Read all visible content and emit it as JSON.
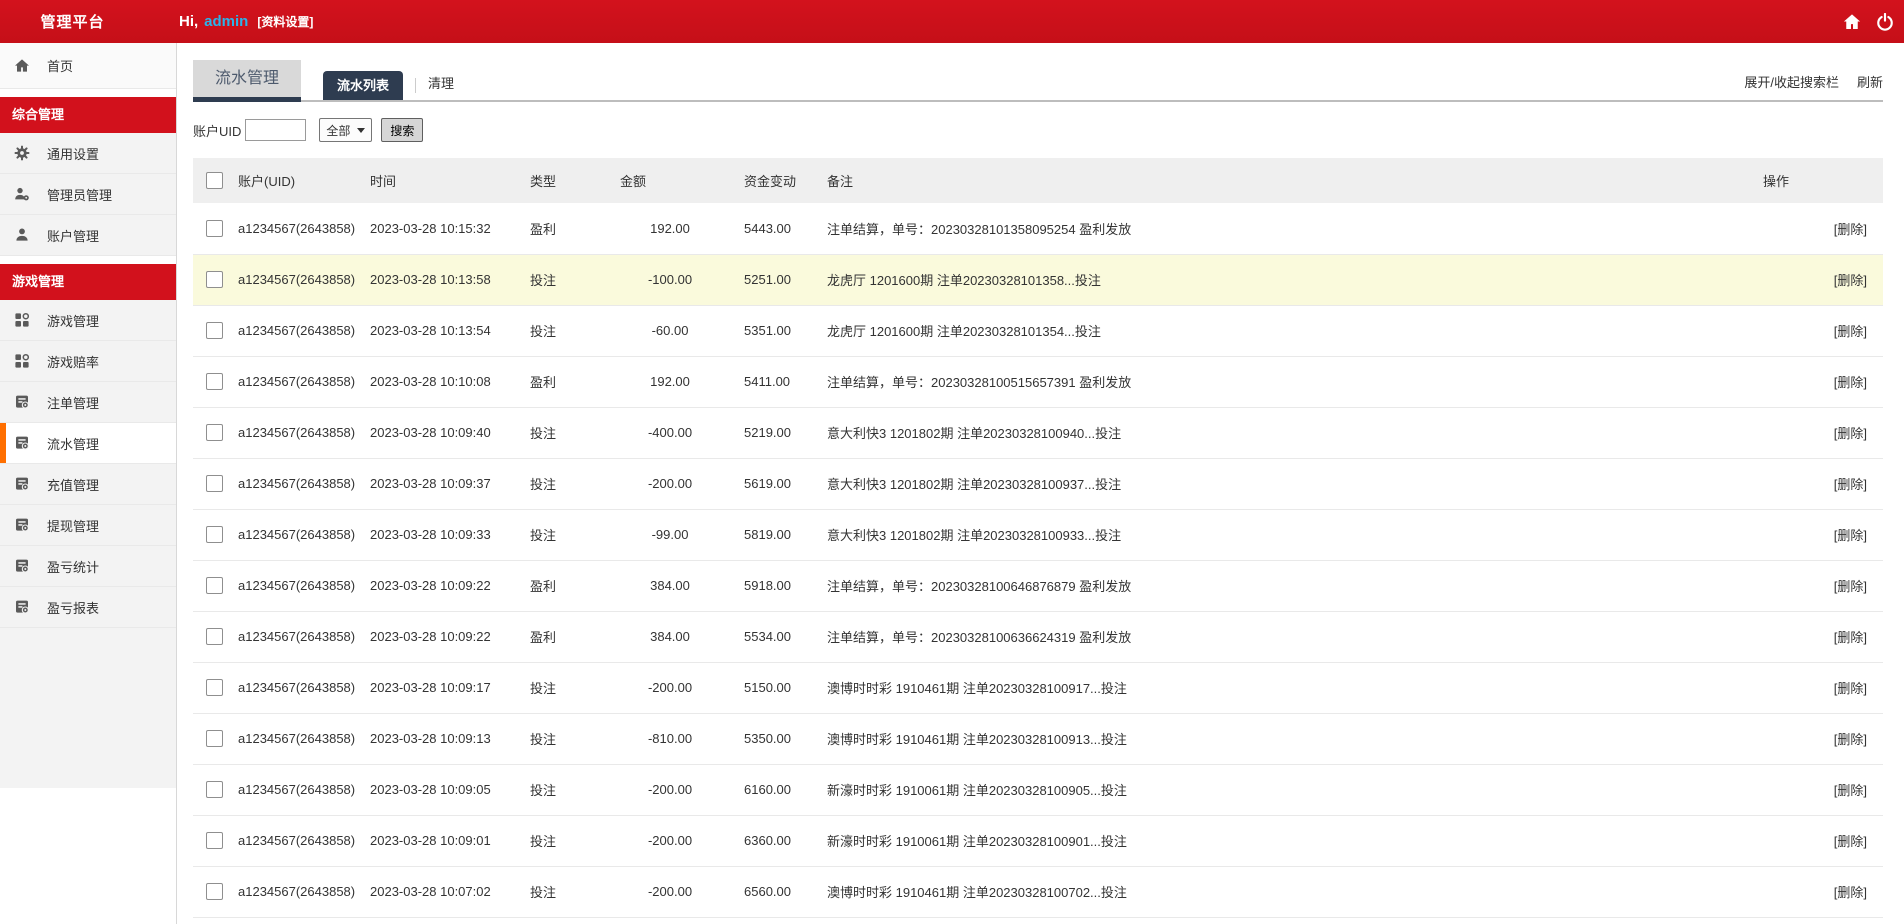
{
  "topbar": {
    "brand": "管理平台",
    "greeting_prefix": "Hi,",
    "username": "admin",
    "profile_link": "[资料设置]",
    "icons": [
      "home-icon",
      "power-icon"
    ]
  },
  "colors": {
    "accent_red": "#d2111c",
    "active_orange": "#ff6f00",
    "tab_navy": "#2e3c50",
    "profit_red": "#e80000",
    "bet_green": "#00a651",
    "row_highlight": "#fafadc"
  },
  "sidebar": {
    "items": [
      {
        "type": "item",
        "name": "home",
        "icon": "home-icon",
        "label": "首页",
        "active": false
      },
      {
        "type": "section",
        "name": "section-comprehensive",
        "label": "综合管理"
      },
      {
        "type": "item",
        "name": "general-settings",
        "icon": "gear-icon",
        "label": "通用设置",
        "active": false
      },
      {
        "type": "item",
        "name": "admin-management",
        "icon": "admins-icon",
        "label": "管理员管理",
        "active": false
      },
      {
        "type": "item",
        "name": "account-management",
        "icon": "user-icon",
        "label": "账户管理",
        "active": false
      },
      {
        "type": "section",
        "name": "section-games",
        "label": "游戏管理"
      },
      {
        "type": "item",
        "name": "game-management",
        "icon": "grid-icon",
        "label": "游戏管理",
        "active": false
      },
      {
        "type": "item",
        "name": "game-odds",
        "icon": "grid-icon",
        "label": "游戏赔率",
        "active": false
      },
      {
        "type": "item",
        "name": "bet-order-management",
        "icon": "report-icon",
        "label": "注单管理",
        "active": false
      },
      {
        "type": "item",
        "name": "flow-management",
        "icon": "report-icon",
        "label": "流水管理",
        "active": true
      },
      {
        "type": "item",
        "name": "recharge-management",
        "icon": "report-icon",
        "label": "充值管理",
        "active": false
      },
      {
        "type": "item",
        "name": "withdrawal-management",
        "icon": "report-icon",
        "label": "提现管理",
        "active": false
      },
      {
        "type": "item",
        "name": "profit-loss-stats",
        "icon": "report-icon",
        "label": "盈亏统计",
        "active": false
      },
      {
        "type": "item",
        "name": "profit-loss-report",
        "icon": "report-icon",
        "label": "盈亏报表",
        "active": false
      }
    ]
  },
  "main": {
    "module_title": "流水管理",
    "tabs": [
      {
        "label": "流水列表",
        "active": true
      },
      {
        "label": "清理",
        "active": false
      }
    ],
    "toolbar": {
      "expand_label": "展开/收起搜索栏",
      "refresh_label": "刷新"
    },
    "search": {
      "label": "账户UID",
      "input_value": "",
      "select_value": "全部",
      "button_label": "搜索"
    },
    "table": {
      "columns": [
        "账户(UID)",
        "时间",
        "类型",
        "金额",
        "资金变动",
        "备注",
        "操作"
      ],
      "action_label": "[删除]",
      "rows": [
        {
          "account": "a1234567(2643858)",
          "time": "2023-03-28 10:15:32",
          "type": "盈利",
          "type_kind": "profit",
          "amount": "192.00",
          "balance": "5443.00",
          "remark": "注单结算，单号：20230328101358095254 盈利发放",
          "highlighted": false
        },
        {
          "account": "a1234567(2643858)",
          "time": "2023-03-28 10:13:58",
          "type": "投注",
          "type_kind": "bet",
          "amount": "-100.00",
          "balance": "5251.00",
          "remark": "龙虎厅 1201600期 注单20230328101358...投注",
          "highlighted": true
        },
        {
          "account": "a1234567(2643858)",
          "time": "2023-03-28 10:13:54",
          "type": "投注",
          "type_kind": "bet",
          "amount": "-60.00",
          "balance": "5351.00",
          "remark": "龙虎厅 1201600期 注单20230328101354...投注",
          "highlighted": false
        },
        {
          "account": "a1234567(2643858)",
          "time": "2023-03-28 10:10:08",
          "type": "盈利",
          "type_kind": "profit",
          "amount": "192.00",
          "balance": "5411.00",
          "remark": "注单结算，单号：20230328100515657391 盈利发放",
          "highlighted": false
        },
        {
          "account": "a1234567(2643858)",
          "time": "2023-03-28 10:09:40",
          "type": "投注",
          "type_kind": "bet",
          "amount": "-400.00",
          "balance": "5219.00",
          "remark": "意大利快3 1201802期 注单20230328100940...投注",
          "highlighted": false
        },
        {
          "account": "a1234567(2643858)",
          "time": "2023-03-28 10:09:37",
          "type": "投注",
          "type_kind": "bet",
          "amount": "-200.00",
          "balance": "5619.00",
          "remark": "意大利快3 1201802期 注单20230328100937...投注",
          "highlighted": false
        },
        {
          "account": "a1234567(2643858)",
          "time": "2023-03-28 10:09:33",
          "type": "投注",
          "type_kind": "bet",
          "amount": "-99.00",
          "balance": "5819.00",
          "remark": "意大利快3 1201802期 注单20230328100933...投注",
          "highlighted": false
        },
        {
          "account": "a1234567(2643858)",
          "time": "2023-03-28 10:09:22",
          "type": "盈利",
          "type_kind": "profit",
          "amount": "384.00",
          "balance": "5918.00",
          "remark": "注单结算，单号：20230328100646876879 盈利发放",
          "highlighted": false
        },
        {
          "account": "a1234567(2643858)",
          "time": "2023-03-28 10:09:22",
          "type": "盈利",
          "type_kind": "profit",
          "amount": "384.00",
          "balance": "5534.00",
          "remark": "注单结算，单号：20230328100636624319 盈利发放",
          "highlighted": false
        },
        {
          "account": "a1234567(2643858)",
          "time": "2023-03-28 10:09:17",
          "type": "投注",
          "type_kind": "bet",
          "amount": "-200.00",
          "balance": "5150.00",
          "remark": "澳博时时彩 1910461期 注单20230328100917...投注",
          "highlighted": false
        },
        {
          "account": "a1234567(2643858)",
          "time": "2023-03-28 10:09:13",
          "type": "投注",
          "type_kind": "bet",
          "amount": "-810.00",
          "balance": "5350.00",
          "remark": "澳博时时彩 1910461期 注单20230328100913...投注",
          "highlighted": false
        },
        {
          "account": "a1234567(2643858)",
          "time": "2023-03-28 10:09:05",
          "type": "投注",
          "type_kind": "bet",
          "amount": "-200.00",
          "balance": "6160.00",
          "remark": "新濠时时彩 1910061期 注单20230328100905...投注",
          "highlighted": false
        },
        {
          "account": "a1234567(2643858)",
          "time": "2023-03-28 10:09:01",
          "type": "投注",
          "type_kind": "bet",
          "amount": "-200.00",
          "balance": "6360.00",
          "remark": "新濠时时彩 1910061期 注单20230328100901...投注",
          "highlighted": false
        },
        {
          "account": "a1234567(2643858)",
          "time": "2023-03-28 10:07:02",
          "type": "投注",
          "type_kind": "bet",
          "amount": "-200.00",
          "balance": "6560.00",
          "remark": "澳博时时彩 1910461期 注单20230328100702...投注",
          "highlighted": false
        }
      ]
    }
  }
}
